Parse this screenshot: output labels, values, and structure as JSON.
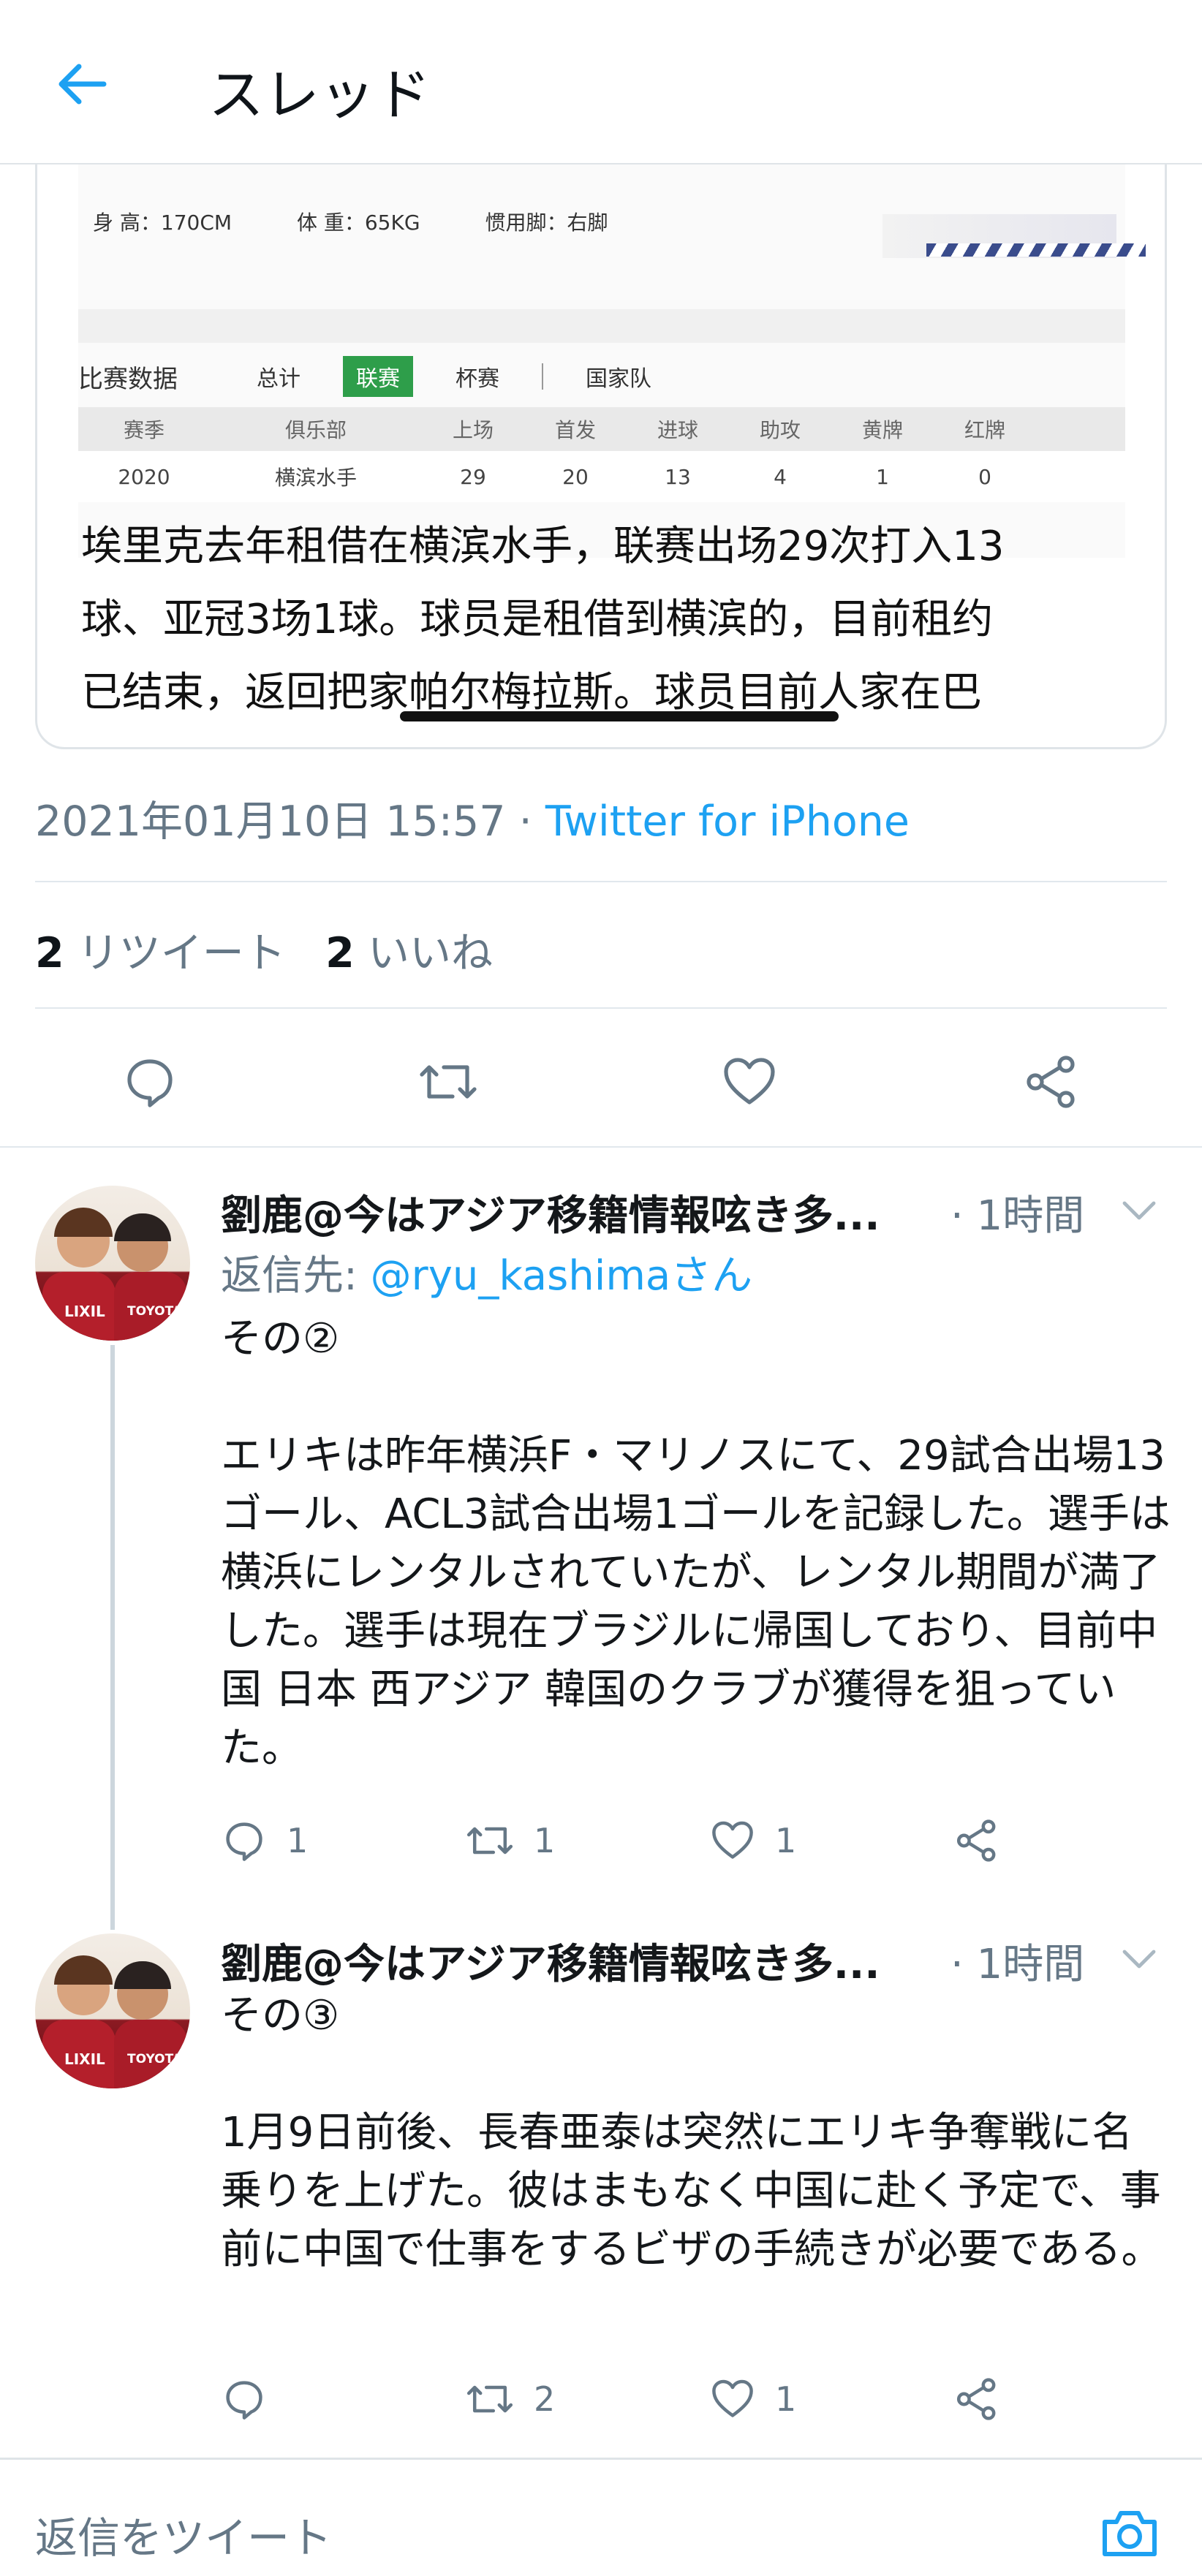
{
  "header": {
    "title": "スレッド",
    "back_icon": "arrow-left-icon",
    "accent_color": "#1da1f2"
  },
  "tweet": {
    "image_card": {
      "profile": {
        "height": "身 高：170CM",
        "weight": "体 重：65KG",
        "foot": "惯用脚：右脚"
      },
      "stats": {
        "title": "比赛数据",
        "tabs": [
          "总计",
          "联赛",
          "杯赛",
          "国家队"
        ],
        "active_tab": "联赛",
        "columns": [
          "赛季",
          "俱乐部",
          "上场",
          "首发",
          "进球",
          "助攻",
          "黄牌",
          "红牌"
        ],
        "rows": [
          [
            "2020",
            "横滨水手",
            "29",
            "20",
            "13",
            "4",
            "1",
            "0"
          ]
        ]
      },
      "text_lines": [
        "埃里克去年租借在横滨水手，联赛出场29次打入13",
        "球、亚冠3场1球。球员是租借到横滨的，目前租约",
        "已结束，返回把家帕尔梅拉斯。球员目前人家在巴"
      ]
    },
    "timestamp": "2021年01月10日 15:57",
    "separator": " · ",
    "source": "Twitter for iPhone",
    "retweets_count": "2",
    "retweets_label": "リツイート",
    "likes_count": "2",
    "likes_label": "いいね",
    "actions": [
      "reply-icon",
      "retweet-icon",
      "like-icon",
      "share-icon"
    ]
  },
  "replies": [
    {
      "name": "劉鹿@今はアジア移籍情報呟き多...",
      "time": "· 1時間",
      "reply_to_prefix": "返信先: ",
      "reply_to_handle": "@ryu_kashimaさん",
      "paragraphs": [
        "その②",
        "エリキは昨年横浜F・マリノスにて、29試合出場13ゴール、ACL3試合出場1ゴールを記録した。選手は横浜にレンタルされていたが、レンタル期間が満了した。選手は現在ブラジルに帰国しており、目前中国 日本 西アジア 韓国のクラブが獲得を狙っていた。"
      ],
      "counts": {
        "reply": "1",
        "retweet": "1",
        "like": "1"
      }
    },
    {
      "name": "劉鹿@今はアジア移籍情報呟き多...",
      "time": "· 1時間",
      "paragraphs": [
        "その③",
        "1月9日前後、長春亜泰は突然にエリキ争奪戦に名乗りを上げた。彼はまもなく中国に赴く予定で、事前に中国で仕事をするビザの手続きが必要である。"
      ],
      "counts": {
        "reply": "",
        "retweet": "2",
        "like": "1"
      }
    }
  ],
  "compose": {
    "placeholder": "返信をツイート",
    "camera_icon": "camera-icon"
  }
}
